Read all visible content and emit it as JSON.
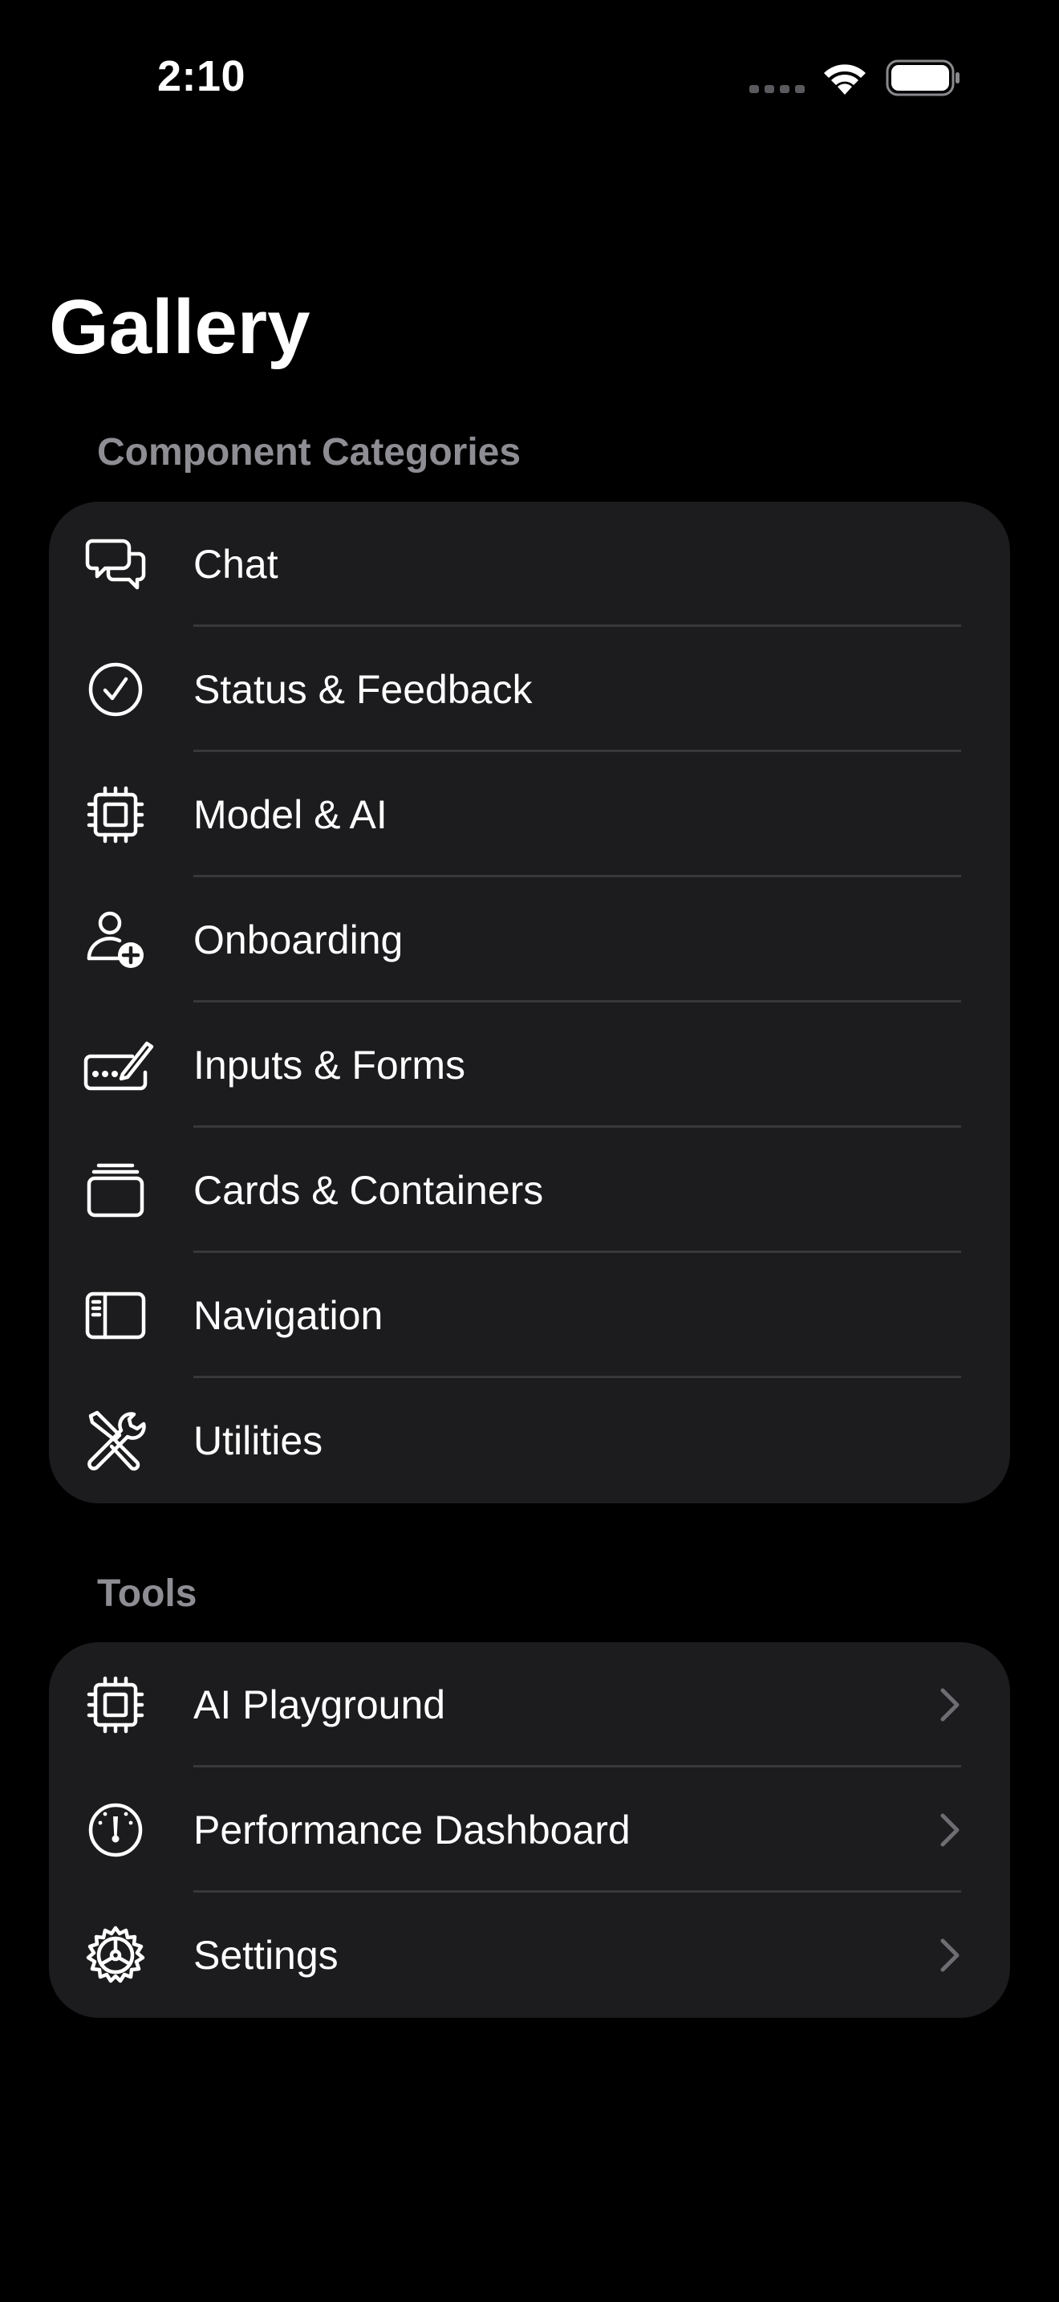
{
  "status_bar": {
    "time": "2:10"
  },
  "title": "Gallery",
  "component_categories": {
    "header": "Component Categories",
    "items": [
      {
        "label": "Chat",
        "icon": "chat-bubbles-icon"
      },
      {
        "label": "Status & Feedback",
        "icon": "checkmark-circle-icon"
      },
      {
        "label": "Model & AI",
        "icon": "cpu-chip-icon"
      },
      {
        "label": "Onboarding",
        "icon": "person-add-icon"
      },
      {
        "label": "Inputs & Forms",
        "icon": "keyboard-pencil-icon"
      },
      {
        "label": "Cards & Containers",
        "icon": "card-stack-icon"
      },
      {
        "label": "Navigation",
        "icon": "sidebar-icon"
      },
      {
        "label": "Utilities",
        "icon": "wrench-screwdriver-icon"
      }
    ]
  },
  "tools": {
    "header": "Tools",
    "items": [
      {
        "label": "AI Playground",
        "icon": "cpu-chip-icon"
      },
      {
        "label": "Performance Dashboard",
        "icon": "gauge-icon"
      },
      {
        "label": "Settings",
        "icon": "gear-icon"
      }
    ]
  },
  "colors": {
    "background": "#000000",
    "group_background": "#1c1c1e",
    "separator": "#38383a",
    "section_header": "#8d8d93",
    "chevron": "#6d6d72"
  }
}
